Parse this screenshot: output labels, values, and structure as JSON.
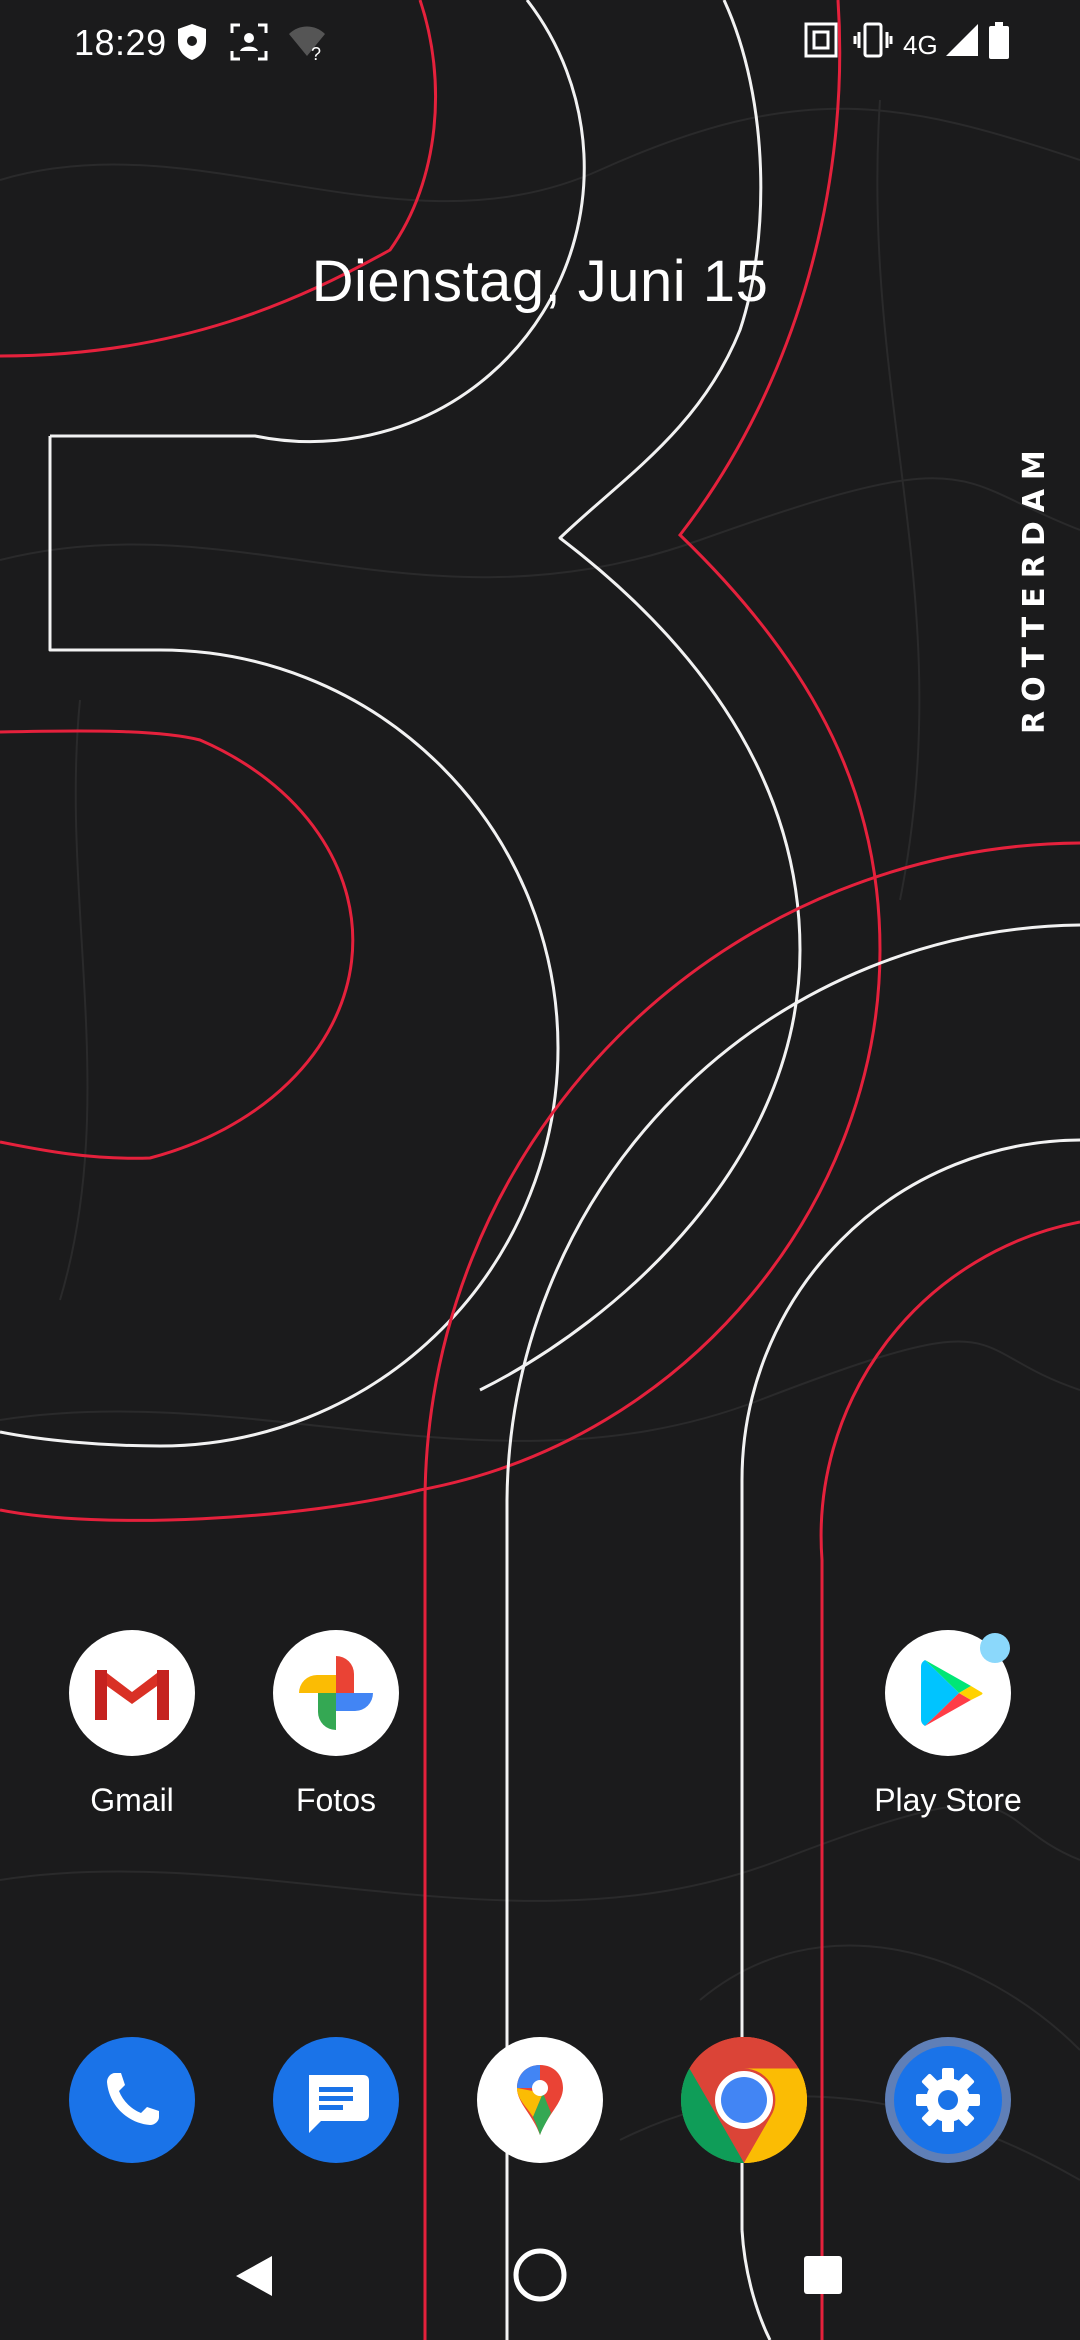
{
  "status_bar": {
    "time": "18:29",
    "network_type": "4G",
    "icons": [
      "shield-icon",
      "face-scan-icon",
      "wifi-unknown-icon",
      "nfc-icon",
      "vibrate-icon",
      "signal-icon",
      "battery-icon"
    ]
  },
  "home": {
    "date": "Dienstag, Juni 15",
    "wallpaper_text": "ROTTERDAM"
  },
  "apps": [
    {
      "label": "Gmail",
      "icon": "gmail-icon"
    },
    {
      "label": "Fotos",
      "icon": "photos-icon"
    },
    {
      "label": "Play Store",
      "icon": "play-store-icon",
      "has_badge": true
    }
  ],
  "dock": [
    {
      "icon": "phone-icon",
      "color": "#1a73e8"
    },
    {
      "icon": "messages-icon",
      "color": "#1a73e8"
    },
    {
      "icon": "maps-icon",
      "color": "#ffffff"
    },
    {
      "icon": "chrome-icon",
      "color": "#db4437"
    },
    {
      "icon": "settings-icon",
      "color": "#1a73e8"
    }
  ],
  "navigation": [
    "back-icon",
    "home-icon",
    "recents-icon"
  ],
  "colors": {
    "background": "#1b1b1c",
    "accent_red": "#e5213c",
    "line_white": "#f2f2f2",
    "badge": "#8bd8fb"
  }
}
